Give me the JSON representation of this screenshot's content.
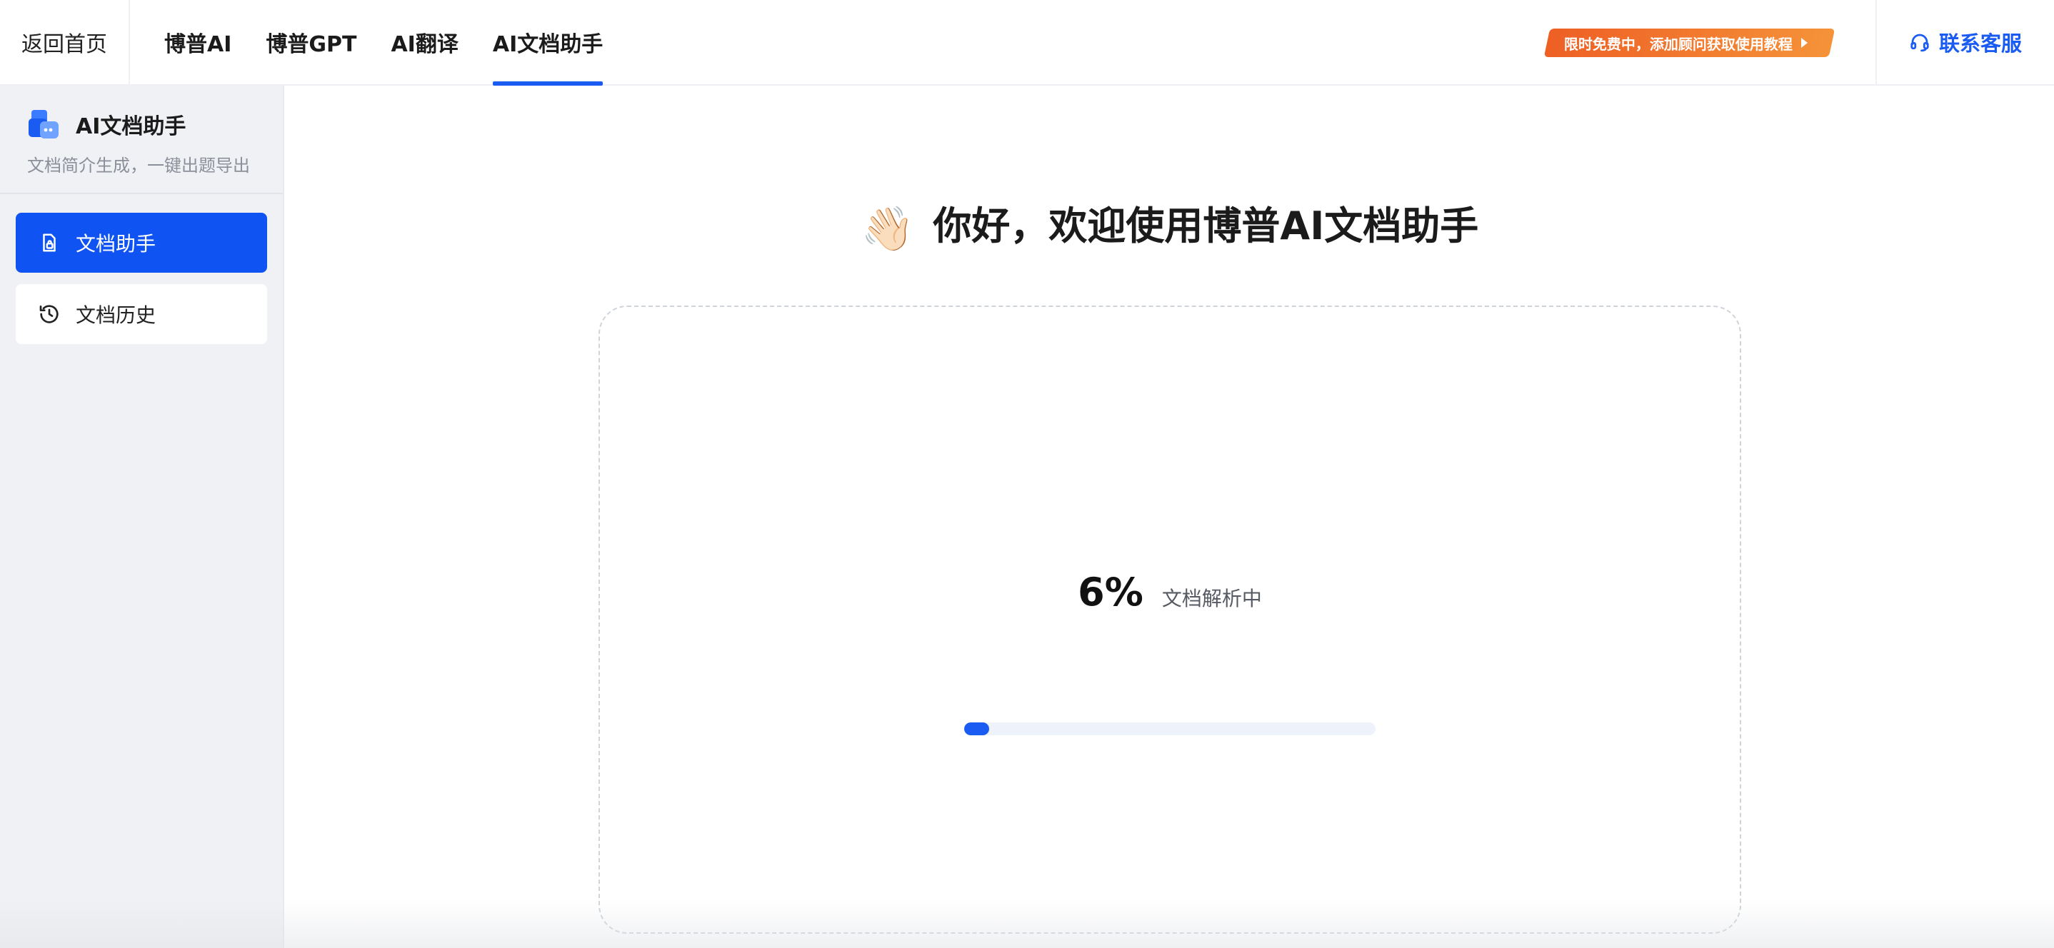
{
  "topbar": {
    "back_label": "返回首页",
    "tabs": [
      {
        "label": "博普AI"
      },
      {
        "label": "博普GPT"
      },
      {
        "label": "AI翻译"
      },
      {
        "label": "AI文档助手"
      }
    ],
    "active_tab": "AI文档助手",
    "promo_label": "限时免费中，添加顾问获取使用教程",
    "support_label": "联系客服"
  },
  "sidebar": {
    "app_title": "AI文档助手",
    "app_subtitle": "文档简介生成，一键出题导出",
    "items": [
      {
        "label": "文档助手",
        "icon": "document-lock-icon",
        "active": true
      },
      {
        "label": "文档历史",
        "icon": "history-icon",
        "active": false
      }
    ]
  },
  "main": {
    "greeting": "你好，欢迎使用博普AI文档助手",
    "greeting_icon": "waving-hand-icon",
    "progress": {
      "percent_label": "6%",
      "value": 6,
      "status": "文档解析中"
    }
  },
  "colors": {
    "accent": "#1a5cf2",
    "sidebar_active": "#0f53f2",
    "promo_start": "#ee5f24",
    "promo_end": "#f59339",
    "sidebar_bg": "#f0f1f5"
  }
}
